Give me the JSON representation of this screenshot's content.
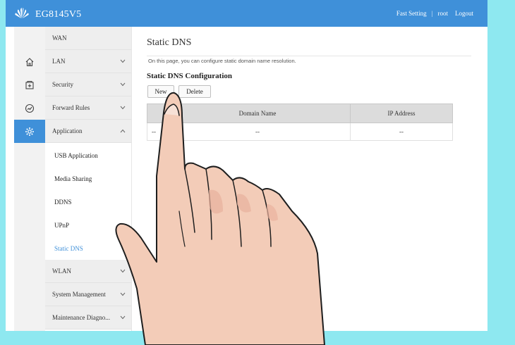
{
  "app": {
    "logo": "huawei-logo",
    "title": "EG8145V5",
    "top_links": [
      "Fast Setting",
      "root",
      "Logout"
    ]
  },
  "colors": {
    "accent": "#3f90d9",
    "background": "#8ee8f0"
  },
  "sidebar_icons": [
    "home-icon",
    "plus-box-icon",
    "speed-dial-icon",
    "gear-icon"
  ],
  "nav": {
    "items": [
      {
        "label": "WAN",
        "chevron": ""
      },
      {
        "label": "LAN",
        "chevron": "⌄"
      },
      {
        "label": "Security",
        "chevron": "⌄"
      },
      {
        "label": "Forward Rules",
        "chevron": "⌄"
      },
      {
        "label": "Application",
        "chevron": "^"
      }
    ],
    "sub_items": [
      {
        "label": "USB Application"
      },
      {
        "label": "Media Sharing"
      },
      {
        "label": "DDNS"
      },
      {
        "label": "UPnP"
      },
      {
        "label": "Static DNS"
      }
    ],
    "lower_items": [
      {
        "label": "WLAN",
        "chevron": "⌄"
      },
      {
        "label": "System Management",
        "chevron": "⌄"
      },
      {
        "label": "Maintenance Diagno...",
        "chevron": "⌄"
      }
    ]
  },
  "main": {
    "title": "Static DNS",
    "description": "On this page, you can configure static domain name resolution.",
    "section_title": "Static DNS Configuration",
    "buttons": {
      "new": "New",
      "delete": "Delete"
    },
    "table": {
      "headers": [
        "",
        "Domain Name",
        "IP Address"
      ],
      "rows": [
        [
          "--",
          "--",
          "--"
        ]
      ]
    }
  }
}
